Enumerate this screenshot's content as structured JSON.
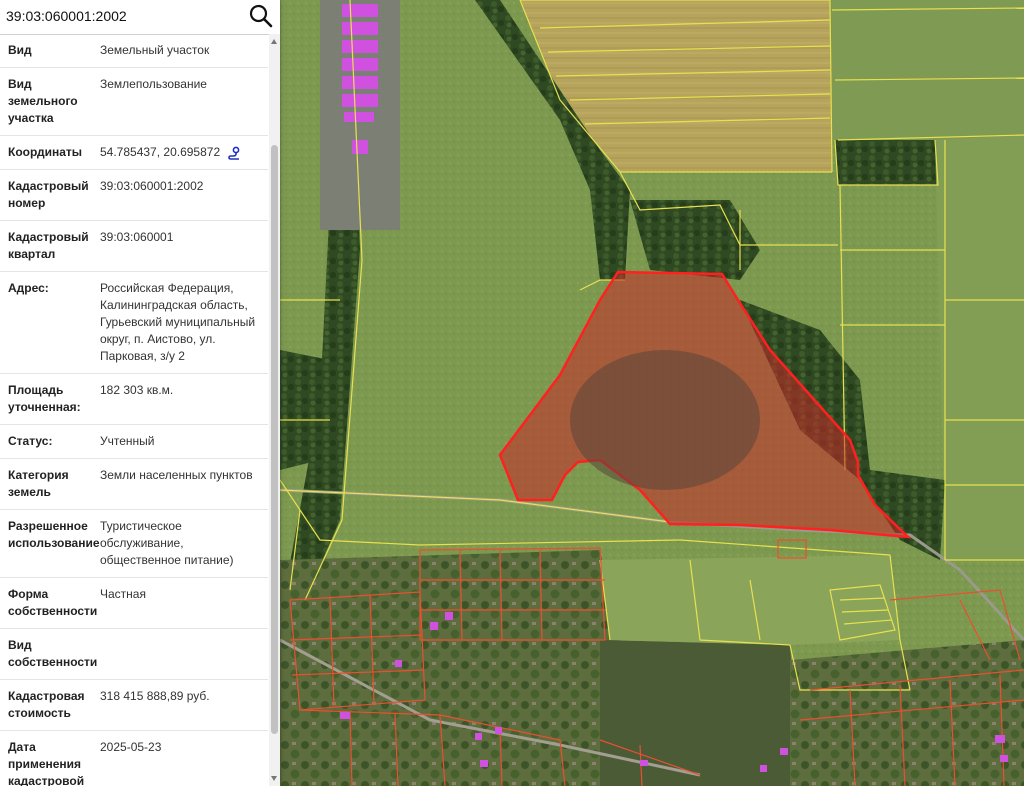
{
  "search": {
    "value": "39:03:060001:2002"
  },
  "fields": [
    {
      "label": "Вид",
      "value": "Земельный участок"
    },
    {
      "label": "Вид земельного участка",
      "value": "Землепользование"
    },
    {
      "label": "Координаты",
      "value": "54.785437, 20.695872"
    },
    {
      "label": "Кадастровый номер",
      "value": "39:03:060001:2002"
    },
    {
      "label": "Кадастровый квартал",
      "value": "39:03:060001"
    },
    {
      "label": "Адрес:",
      "value": "Российская Федерация, Калининградская область, Гурьевский муниципальный округ, п. Аистово, ул. Парковая, з/у 2"
    },
    {
      "label": "Площадь уточненная:",
      "value": "182 303 кв.м."
    },
    {
      "label": "Статус:",
      "value": "Учтенный"
    },
    {
      "label": "Категория земель",
      "value": "Земли населенных пунктов"
    },
    {
      "label": "Разрешенное использование",
      "value": "Туристическое обслуживание, общественное питание)"
    },
    {
      "label": "Форма собственности",
      "value": "Частная"
    },
    {
      "label": "Вид собственности",
      "value": ""
    },
    {
      "label": "Кадастровая стоимость",
      "value": "318 415 888,89 руб."
    },
    {
      "label": "Дата применения кадастровой стоимости",
      "value": "2025-05-23"
    }
  ],
  "colors": {
    "parcel_highlight": "#ff2020",
    "parcel_boundary": "#e8e050",
    "village_boundary": "#e85030",
    "building": "#d050e0"
  },
  "icons": {
    "search": "search-icon",
    "coordinates": "map-pin-route-icon"
  }
}
